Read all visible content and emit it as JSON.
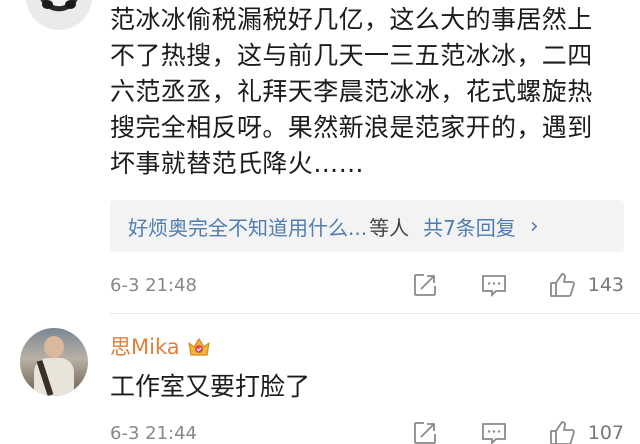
{
  "comment1": {
    "lines": [
      "范冰冰偷税漏税好几亿，这么大的事居然上",
      "不了热搜，这与前几天一三五范冰冰，二四",
      "六范丞丞，礼拜天李晨范冰冰，花式螺旋热",
      "搜完全相反呀。果然新浪是范家开的，遇到",
      "坏事就替范氏降火……"
    ],
    "replies": {
      "users": "好烦奥完全不知道用什么...",
      "suffix": "等人",
      "count": "共7条回复",
      "chevron": "›"
    },
    "time": "6-3 21:48",
    "likes": "143"
  },
  "comment2": {
    "username": "思Mika",
    "badge_icon": "vip-crown-badge-icon",
    "text": "工作室又要打脸了",
    "time": "6-3 21:44",
    "likes": "107"
  },
  "icons": {
    "share": "share-icon",
    "comment": "comment-icon",
    "like": "thumbs-up-icon"
  },
  "colors": {
    "link": "#507daf",
    "username": "#e0803a",
    "meta": "#888888",
    "reply_bg": "#f3f3f3"
  }
}
